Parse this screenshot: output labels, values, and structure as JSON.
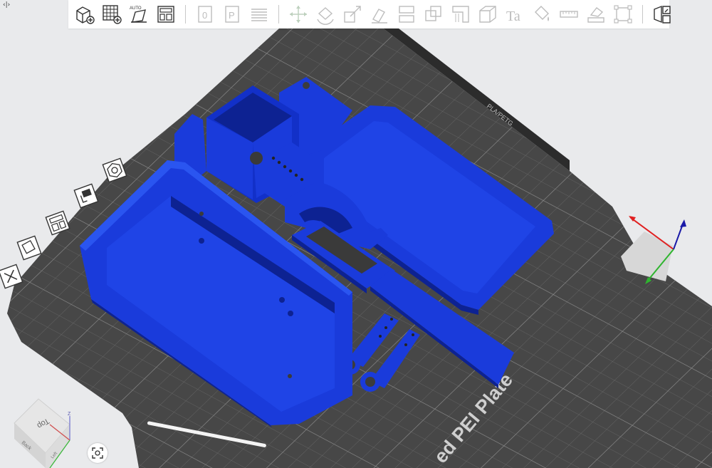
{
  "collapse_glyph": "‹|›",
  "toolbar": {
    "groups": [
      [
        "add-object-icon",
        "grid-add-plate-icon",
        "auto-orient-icon",
        "arrange-layout-icon"
      ],
      [
        "plate-0-icon",
        "plate-p-icon",
        "list-lines-icon"
      ],
      [
        "move-icon",
        "rotate-icon",
        "scale-icon",
        "lay-on-face-icon",
        "cut-icon",
        "split-icon",
        "support-paint-icon",
        "measure-box-icon",
        "text-icon",
        "paint-bucket-icon",
        "ruler-icon",
        "assembly-icon",
        "fit-frame-icon"
      ],
      [
        "assembly-view-icon"
      ]
    ],
    "auto_label": "AUTO",
    "text_label": "Ta"
  },
  "left_tools": [
    "close-x-icon",
    "object-list-icon",
    "layout-grid-icon",
    "color-paint-icon",
    "nut-settings-icon"
  ],
  "plate": {
    "name_text": "ed PEI Plate",
    "edge_text": "PLA/PETG"
  },
  "view_cube": {
    "top_label": "Top",
    "back_label": "Back",
    "left_label": "Left",
    "z_label": "Z"
  },
  "colors": {
    "plate": "#4a4a4a",
    "plate_dark": "#2f2f2f",
    "grid": "#6a6a6a",
    "model": "#1a3bdb",
    "model_dark": "#0d2292",
    "axis_x": "#e02020",
    "axis_y": "#2fb52f",
    "axis_z": "#1a1aa8"
  }
}
